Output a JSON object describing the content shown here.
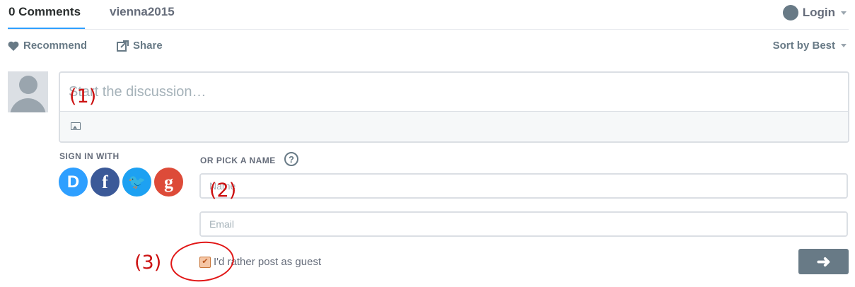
{
  "tabs": {
    "comments": "0 Comments",
    "forum": "vienna2015"
  },
  "login": {
    "label": "Login",
    "icon": "chat-bubble-icon"
  },
  "actions": {
    "recommend": "Recommend",
    "share": "Share",
    "sort": "Sort by Best"
  },
  "composer": {
    "placeholder": "Start the discussion…",
    "toolbar_icon": "image-upload-icon"
  },
  "signin": {
    "label": "SIGN IN WITH",
    "providers": [
      {
        "name": "disqus",
        "glyph": "D",
        "color": "#2e9fff"
      },
      {
        "name": "facebook",
        "glyph": "f",
        "color": "#3b5998"
      },
      {
        "name": "twitter",
        "glyph": "🐦",
        "color": "#1da1f2"
      },
      {
        "name": "google",
        "glyph": "g",
        "color": "#dd4b39"
      }
    ]
  },
  "guest": {
    "pick_label": "OR PICK A NAME",
    "help": "?",
    "name_placeholder": "Name",
    "email_placeholder": "Email",
    "checkbox_label": "I'd rather post as guest",
    "checked": true
  },
  "submit": {
    "icon": "arrow-right-icon",
    "glyph": "➜"
  },
  "annotations": [
    "(1)",
    "(2)",
    "(3)"
  ]
}
